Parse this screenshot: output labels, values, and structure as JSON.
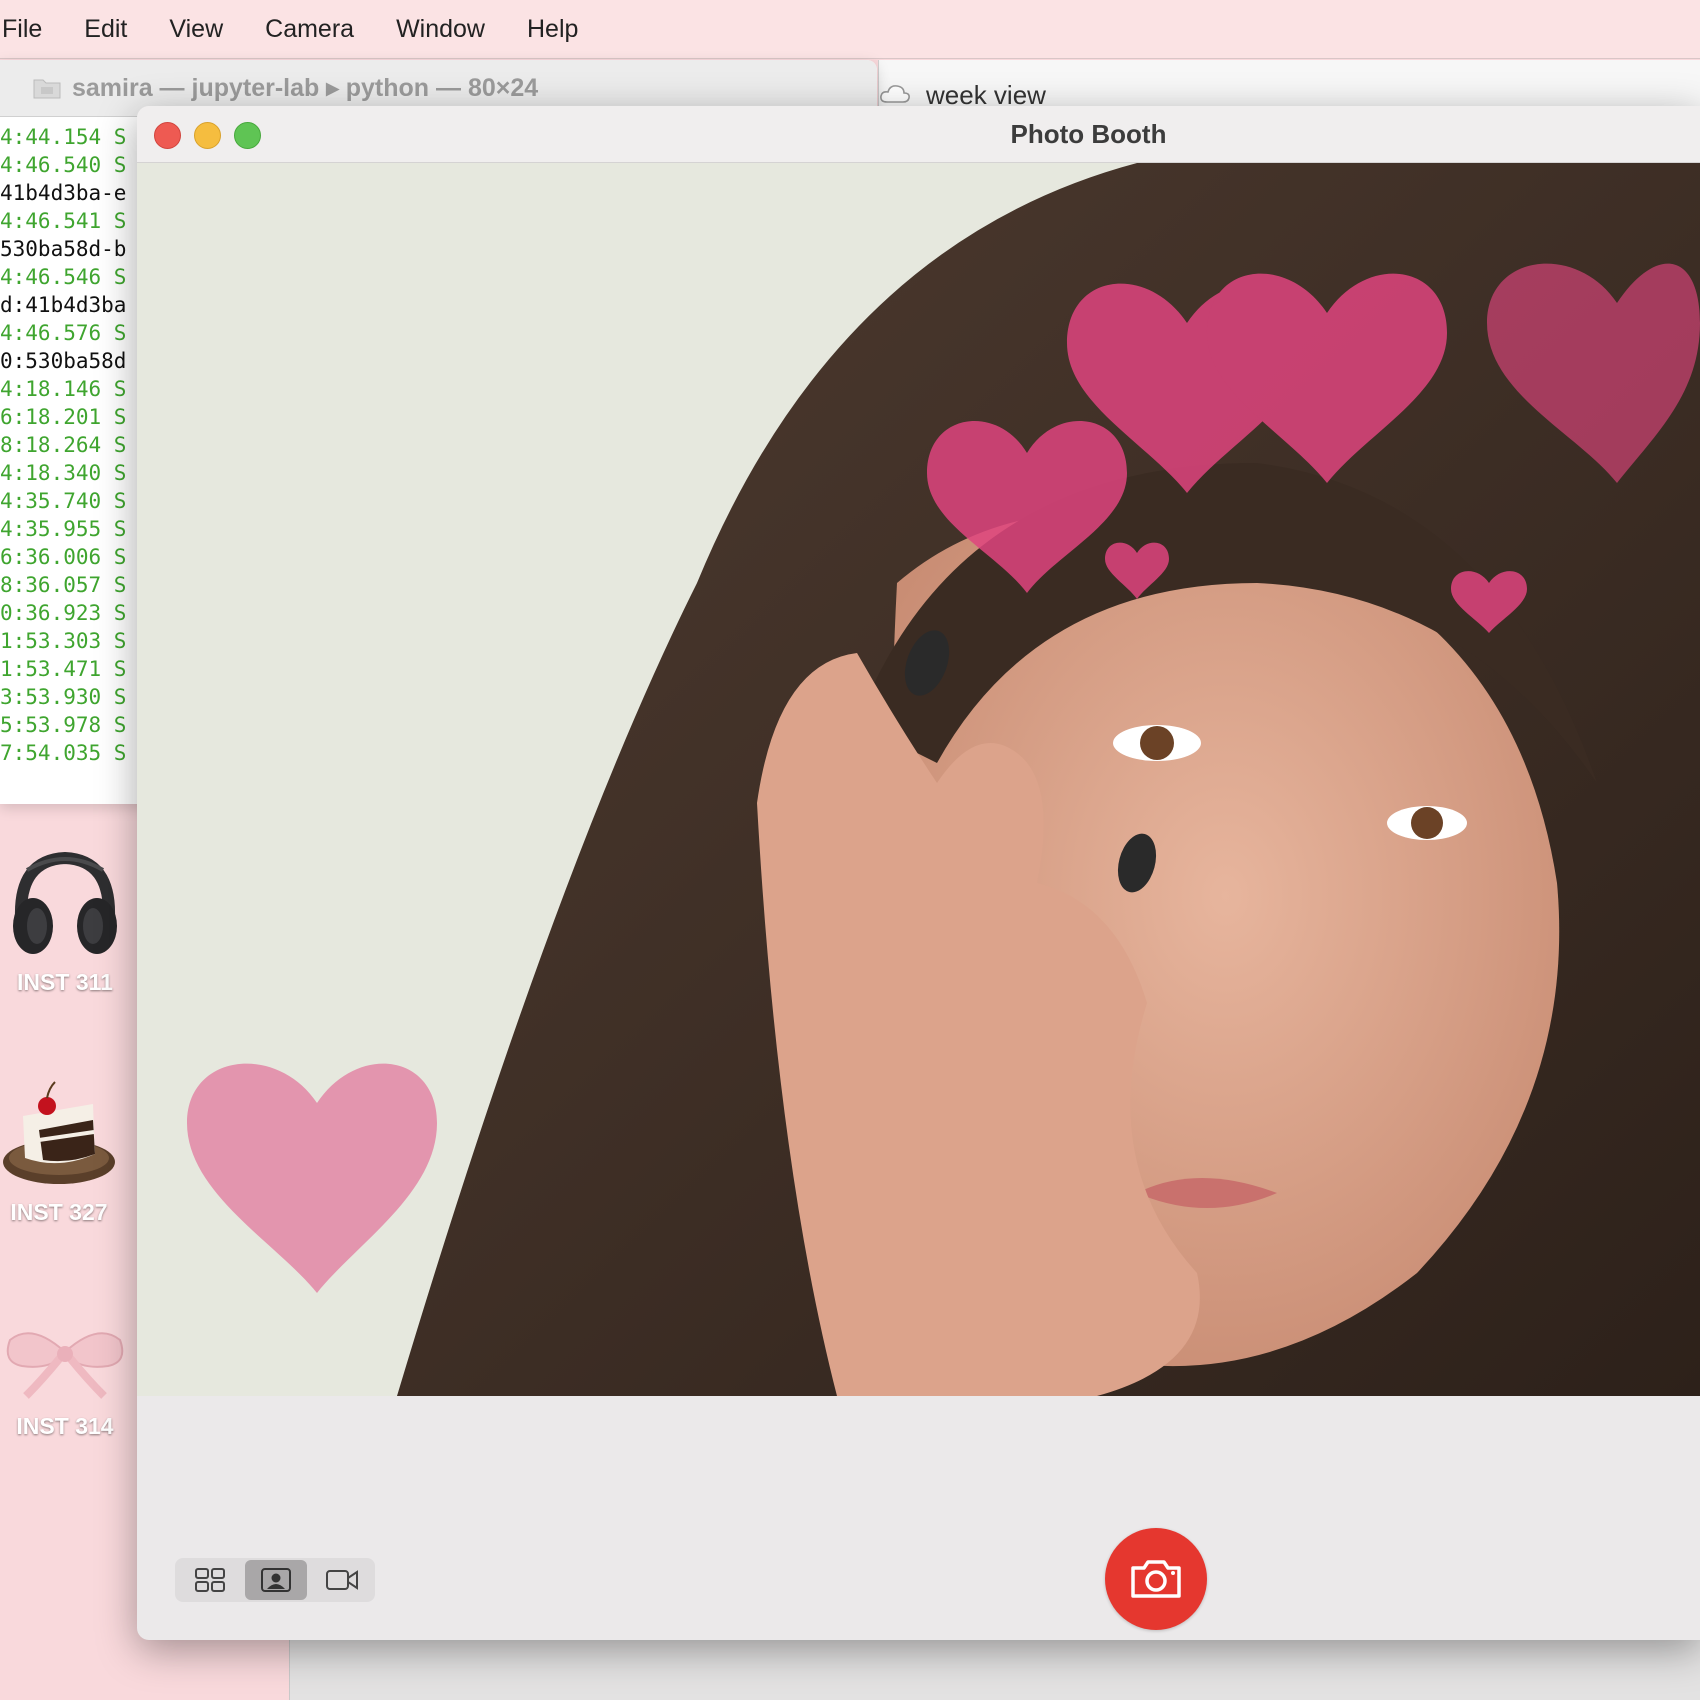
{
  "menubar": {
    "items": [
      "File",
      "Edit",
      "View",
      "Camera",
      "Window",
      "Help"
    ]
  },
  "terminal": {
    "title": "samira — jupyter-lab ▸ python — 80×24",
    "lines": [
      {
        "text": "4:44.154 S",
        "color": "green"
      },
      {
        "text": "4:46.540 S",
        "color": "green"
      },
      {
        "text": "41b4d3ba-e",
        "color": "black"
      },
      {
        "text": "4:46.541 S",
        "color": "green"
      },
      {
        "text": "530ba58d-b",
        "color": "black"
      },
      {
        "text": "4:46.546 S",
        "color": "green"
      },
      {
        "text": "d:41b4d3ba",
        "color": "black"
      },
      {
        "text": "4:46.576 S",
        "color": "green"
      },
      {
        "text": "0:530ba58d",
        "color": "black"
      },
      {
        "text": "4:18.146 S",
        "color": "green"
      },
      {
        "text": "6:18.201 S",
        "color": "green"
      },
      {
        "text": "8:18.264 S",
        "color": "green"
      },
      {
        "text": "4:18.340 S",
        "color": "green"
      },
      {
        "text": "4:35.740 S",
        "color": "green"
      },
      {
        "text": "4:35.955 S",
        "color": "green"
      },
      {
        "text": "6:36.006 S",
        "color": "green"
      },
      {
        "text": "8:36.057 S",
        "color": "green"
      },
      {
        "text": "0:36.923 S",
        "color": "green"
      },
      {
        "text": "1:53.303 S",
        "color": "green"
      },
      {
        "text": "1:53.471 S",
        "color": "green"
      },
      {
        "text": "3:53.930 S",
        "color": "green"
      },
      {
        "text": "5:53.978 S",
        "color": "green"
      },
      {
        "text": "7:54.035 S",
        "color": "green"
      }
    ]
  },
  "calendar": {
    "label": "week view"
  },
  "desktop": {
    "icons": [
      {
        "label": "INST 311",
        "icon": "headphones-icon"
      },
      {
        "label": "INST 327",
        "icon": "cake-icon"
      },
      {
        "label": "INST 314",
        "icon": "bow-icon"
      }
    ]
  },
  "photobooth": {
    "title": "Photo Booth",
    "effect": "hearts",
    "view_modes": [
      "grid-view-icon",
      "photo-view-icon",
      "video-view-icon"
    ],
    "active_view": "photo-view-icon",
    "shutter_icon": "camera-icon"
  },
  "colors": {
    "desktop_bg": "#f9d9dc",
    "shutter": "#e5372f",
    "terminal_green": "#3fa52f",
    "heart": "#e0457f"
  }
}
